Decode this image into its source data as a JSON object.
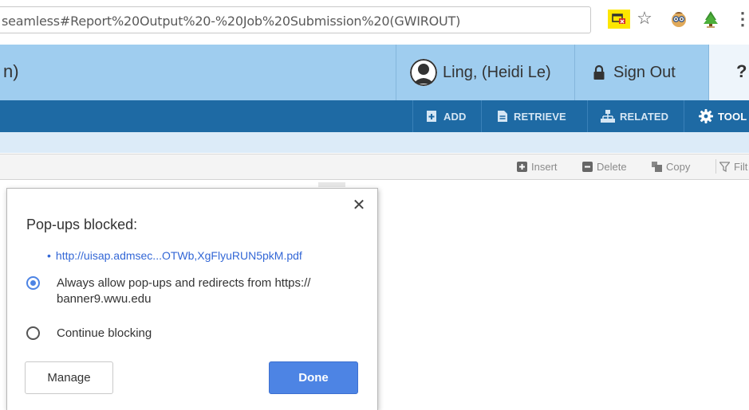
{
  "browser": {
    "url": "seamless#Report%20Output%20-%20Job%20Submission%20(GWIROUT)",
    "icons": {
      "popup_blocked": "popup-blocked-icon",
      "bookmark": "star-icon",
      "extension_1": "extension-icon",
      "extension_2": "extension-icon",
      "menu": "more-vert-icon"
    },
    "star_glyph": "☆",
    "menu_glyph": "⋮",
    "popup_icon_color": "#fde600"
  },
  "header": {
    "title_fragment": "n)",
    "user_name": "Ling, (Heidi Le)",
    "sign_out_label": "Sign Out",
    "help_glyph": "?",
    "background_color": "#9fcdef"
  },
  "toolbar": {
    "background_color": "#1e6aa4",
    "buttons": [
      {
        "label": "ADD",
        "icon": "add-document-icon"
      },
      {
        "label": "RETRIEVE",
        "icon": "document-icon"
      },
      {
        "label": "RELATED",
        "icon": "sitemap-icon"
      },
      {
        "label": "TOOL",
        "icon": "gear-icon"
      }
    ]
  },
  "grid_toolbar": {
    "buttons": [
      {
        "label": "Insert",
        "icon": "plus-square-icon"
      },
      {
        "label": "Delete",
        "icon": "minus-square-icon"
      },
      {
        "label": "Copy",
        "icon": "copy-icon"
      },
      {
        "label": "Filt",
        "icon": "filter-icon"
      }
    ]
  },
  "popup": {
    "title": "Pop-ups blocked:",
    "close_glyph": "✕",
    "bullet": "•",
    "blocked_link": "http://uisap.admsec...OTWb,XgFlyuRUN5pkM.pdf",
    "options": [
      {
        "label": "Always allow pop-ups and redirects from https:// banner9.wwu.edu",
        "selected": true
      },
      {
        "label": "Continue blocking",
        "selected": false
      }
    ],
    "manage_label": "Manage",
    "done_label": "Done",
    "accent_color": "#4d84e4"
  }
}
